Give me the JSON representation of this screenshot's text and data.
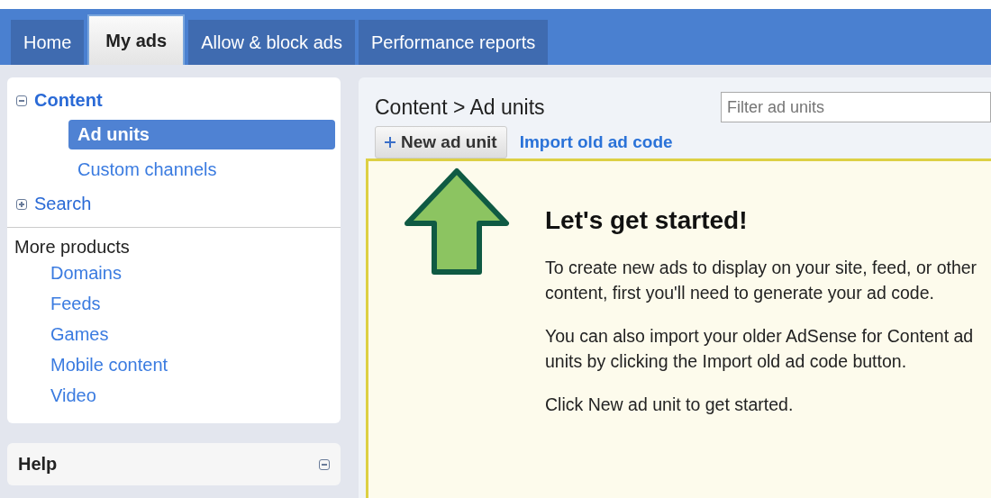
{
  "tabs": [
    {
      "label": "Home",
      "selected": false
    },
    {
      "label": "My ads",
      "selected": true
    },
    {
      "label": "Allow & block ads",
      "selected": false
    },
    {
      "label": "Performance reports",
      "selected": false
    }
  ],
  "sidebar": {
    "sections": [
      {
        "label": "Content",
        "expanded": true,
        "children": [
          {
            "label": "Ad units",
            "selected": true
          },
          {
            "label": "Custom channels",
            "selected": false
          }
        ]
      },
      {
        "label": "Search",
        "expanded": false
      }
    ],
    "more_products": {
      "title": "More products",
      "items": [
        "Domains",
        "Feeds",
        "Games",
        "Mobile content",
        "Video"
      ]
    },
    "help": {
      "title": "Help",
      "expanded": true
    }
  },
  "main": {
    "breadcrumb": "Content > Ad units",
    "filter": {
      "placeholder": "Filter ad units"
    },
    "new_button": "New ad unit",
    "import_link": "Import old ad code",
    "callout": {
      "title": "Let's get started!",
      "paragraphs": [
        "To create new ads to display on your site, feed, or other content, first you'll need to generate your ad code.",
        "You can also import your older AdSense for Content ad units by clicking the Import old ad code button.",
        "Click New ad unit to get started."
      ]
    }
  }
}
